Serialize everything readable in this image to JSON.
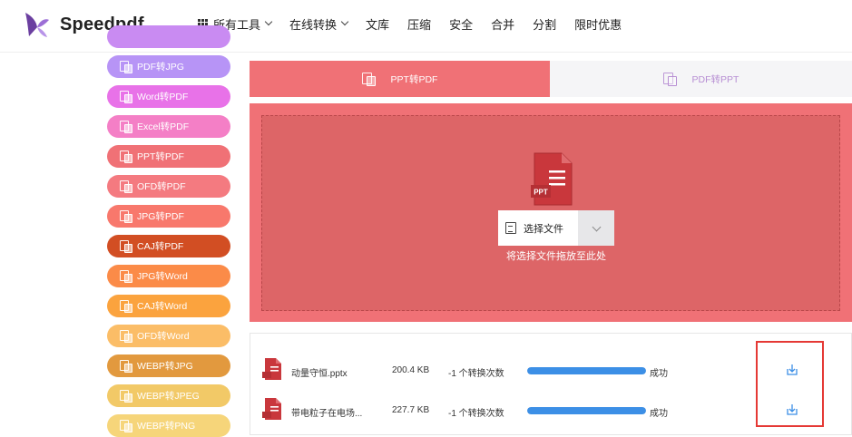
{
  "brand": {
    "name": "Speedpdf"
  },
  "nav": {
    "items": [
      {
        "label": "所有工具",
        "has_grid": true,
        "has_dropdown": true
      },
      {
        "label": "在线转换",
        "has_grid": false,
        "has_dropdown": true
      },
      {
        "label": "文库",
        "has_grid": false,
        "has_dropdown": false
      },
      {
        "label": "压缩",
        "has_grid": false,
        "has_dropdown": false
      },
      {
        "label": "安全",
        "has_grid": false,
        "has_dropdown": false
      },
      {
        "label": "合并",
        "has_grid": false,
        "has_dropdown": false
      },
      {
        "label": "分割",
        "has_grid": false,
        "has_dropdown": false
      },
      {
        "label": "限时优惠",
        "has_grid": false,
        "has_dropdown": false
      }
    ]
  },
  "sidebar": {
    "items": [
      {
        "label": "",
        "color": "#c98bf2"
      },
      {
        "label": "PDF转JPG",
        "color": "#b794f6"
      },
      {
        "label": "Word转PDF",
        "color": "#e872e8"
      },
      {
        "label": "Excel转PDF",
        "color": "#f47fc6"
      },
      {
        "label": "PPT转PDF",
        "color": "#f07176"
      },
      {
        "label": "OFD转PDF",
        "color": "#f47a80"
      },
      {
        "label": "JPG转PDF",
        "color": "#f8786c"
      },
      {
        "label": "CAJ转PDF",
        "color": "#d24e23"
      },
      {
        "label": "JPG转Word",
        "color": "#fb8b48"
      },
      {
        "label": "CAJ转Word",
        "color": "#fba33e"
      },
      {
        "label": "OFD转Word",
        "color": "#fbbd67"
      },
      {
        "label": "WEBP转JPG",
        "color": "#e2993e"
      },
      {
        "label": "WEBP转JPEG",
        "color": "#f2c967"
      },
      {
        "label": "WEBP转PNG",
        "color": "#f6d57a"
      }
    ]
  },
  "tabs": {
    "active": {
      "label": "PPT转PDF",
      "color": "#f07176"
    },
    "inactive": {
      "label": "PDF转PPT",
      "color": "#b78ed3"
    }
  },
  "upload": {
    "file_type_badge": "PPT",
    "select_label": "选择文件",
    "drop_hint": "将选择文件拖放至此处"
  },
  "files": [
    {
      "name": "动量守恒.pptx",
      "size": "200.4 KB",
      "conversions": "-1 个转换次数",
      "progress": 1.0,
      "status": "成功"
    },
    {
      "name": "带电粒子在电场...",
      "size": "227.7 KB",
      "conversions": "-1 个转换次数",
      "progress": 1.0,
      "status": "成功"
    }
  ],
  "colors": {
    "accent": "#f07176",
    "progress": "#3c8fe6",
    "download": "#3c8fe6",
    "highlight": "#e53935"
  }
}
